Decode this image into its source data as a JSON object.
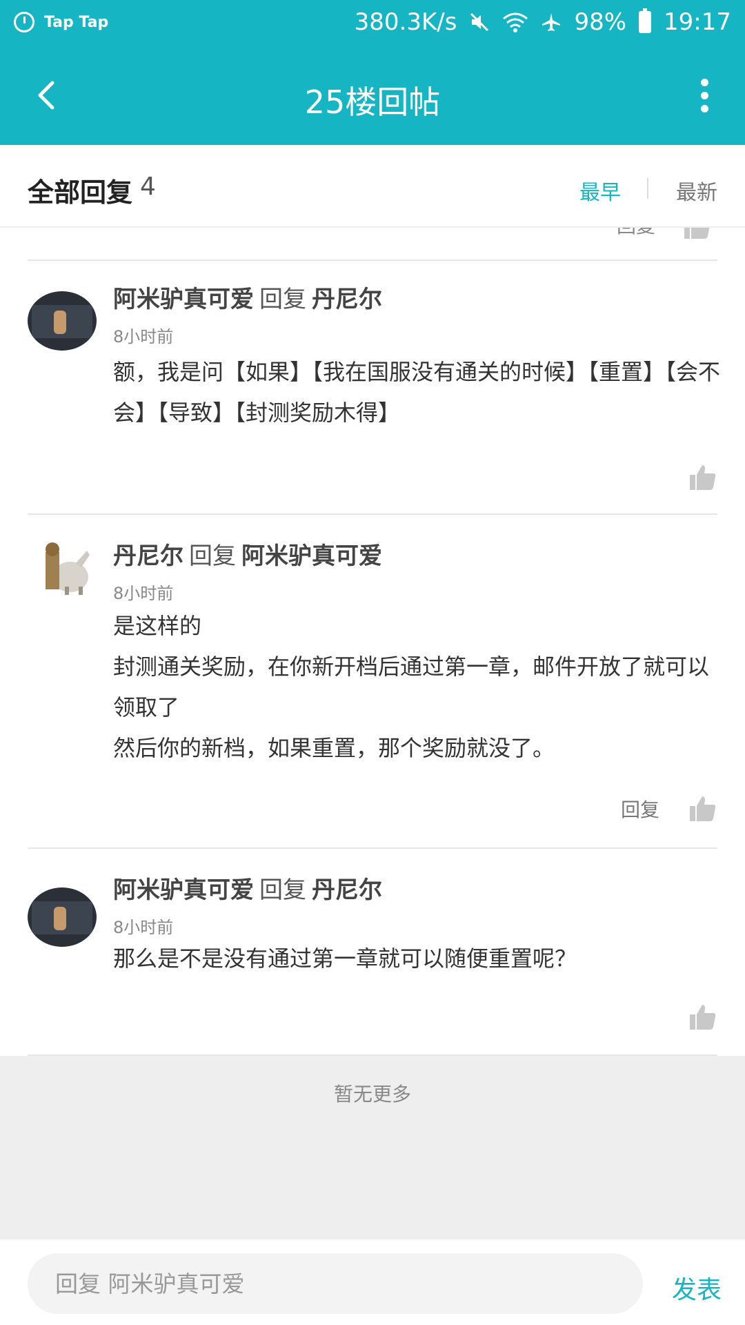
{
  "status_bar": {
    "left_text": "Tap Tap",
    "network_speed": "380.3K/s",
    "battery": "98%",
    "time": "19:17",
    "icons": [
      "timer-icon",
      "mute-icon",
      "wifi-icon",
      "airplane-icon",
      "battery-icon"
    ]
  },
  "app_bar": {
    "title": "25楼回帖",
    "back_icon": "chevron-left-icon",
    "more_icon": "more-vertical-icon",
    "color": "#15b5c4"
  },
  "sort": {
    "title": "全部回复",
    "count": "4",
    "earliest": "最早",
    "latest": "最新",
    "active": "earliest"
  },
  "peek_row": {
    "reply_label": "回复"
  },
  "comments": [
    {
      "author": "阿米驴真可爱",
      "reply_word": "回复",
      "reply_to": "丹尼尔",
      "time": "8小时前",
      "lines": [
        "额，我是问【如果】【我在国服没有通关的时候】【重置】【会不会】【导致】【封测奖励木得】"
      ],
      "reply_label": ""
    },
    {
      "author": "丹尼尔",
      "reply_word": "回复",
      "reply_to": "阿米驴真可爱",
      "time": "8小时前",
      "lines": [
        "是这样的",
        "封测通关奖励，在你新开档后通过第一章，邮件开放了就可以领取了",
        "然后你的新档，如果重置，那个奖励就没了。"
      ],
      "reply_label": "回复"
    },
    {
      "author": "阿米驴真可爱",
      "reply_word": "回复",
      "reply_to": "丹尼尔",
      "time": "8小时前",
      "lines": [
        "那么是不是没有通过第一章就可以随便重置呢？"
      ],
      "reply_label": ""
    }
  ],
  "no_more": "暂无更多",
  "input": {
    "placeholder": "回复 阿米驴真可爱",
    "send": "发表"
  }
}
